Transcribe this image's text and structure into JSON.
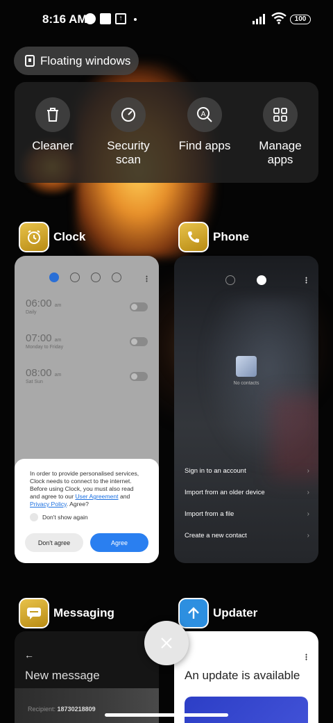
{
  "status_bar": {
    "time": "8:16 AM",
    "battery": "100"
  },
  "floating_windows": {
    "label": "Floating windows"
  },
  "tools": [
    {
      "label": "Cleaner",
      "icon": "trash-icon"
    },
    {
      "label": "Security scan",
      "icon": "security-scan-icon"
    },
    {
      "label": "Find apps",
      "icon": "find-apps-icon"
    },
    {
      "label": "Manage apps",
      "icon": "grid-icon"
    }
  ],
  "recent_apps": {
    "clock": {
      "name": "Clock",
      "alarms": [
        {
          "time": "06:00",
          "ampm": "am",
          "repeat": "Daily"
        },
        {
          "time": "07:00",
          "ampm": "am",
          "repeat": "Monday to Friday"
        },
        {
          "time": "08:00",
          "ampm": "am",
          "repeat": "Sat Sun"
        }
      ],
      "dialog": {
        "text_part1": "In order to provide personalised services, Clock needs to connect to the internet. Before using Clock, you must also read and agree to our ",
        "link1": "User Agreement",
        "text_part2": " and ",
        "link2": "Privacy Policy",
        "text_part3": ". Agree?",
        "checkbox_label": "Don't show again",
        "decline_label": "Don't agree",
        "accept_label": "Agree"
      }
    },
    "phone": {
      "name": "Phone",
      "empty_label": "No contacts",
      "options": [
        "Sign in to an account",
        "Import from an older device",
        "Import from a file",
        "Create a new contact"
      ]
    },
    "messaging": {
      "name": "Messaging",
      "title": "New message",
      "recipient_label": "Recipient:",
      "recipient_value": "18730218809"
    },
    "updater": {
      "name": "Updater",
      "title": "An update is available"
    }
  },
  "colors": {
    "accent_blue": "#2a7ff0",
    "clock_icon": "#d4aa2c",
    "updater_icon": "#2d8fe0"
  }
}
